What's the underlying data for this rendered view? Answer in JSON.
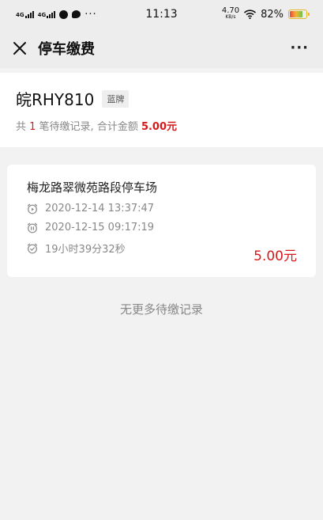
{
  "status_bar": {
    "net1": "4G",
    "net2": "4G",
    "more": "···",
    "time": "11:13",
    "speed_value": "4.70",
    "speed_unit": "KB/s",
    "battery": "82%"
  },
  "nav": {
    "title": "停车缴费",
    "more": "···"
  },
  "summary": {
    "plate": "皖RHY810",
    "plate_color_tag": "蓝牌",
    "prefix": "共 ",
    "count": "1",
    "middle": " 笔待缴记录, 合计金额 ",
    "total": "5.00元"
  },
  "record": {
    "lot_name": "梅龙路翠微苑路段停车场",
    "entry_time": "2020-12-14 13:37:47",
    "exit_time": "2020-12-15 09:17:19",
    "duration": "19小时39分32秒",
    "fee": "5.00元"
  },
  "footer": {
    "no_more": "无更多待缴记录"
  },
  "colors": {
    "accent_red": "#d41a1a",
    "muted_text": "#888888",
    "background": "#f2f2f2"
  },
  "icons": {
    "close": "close-icon",
    "more": "more-icon",
    "entry": "alarm-clock-icon",
    "exit": "pause-clock-icon",
    "duration": "check-clock-icon"
  },
  "battery_level": 0.82
}
